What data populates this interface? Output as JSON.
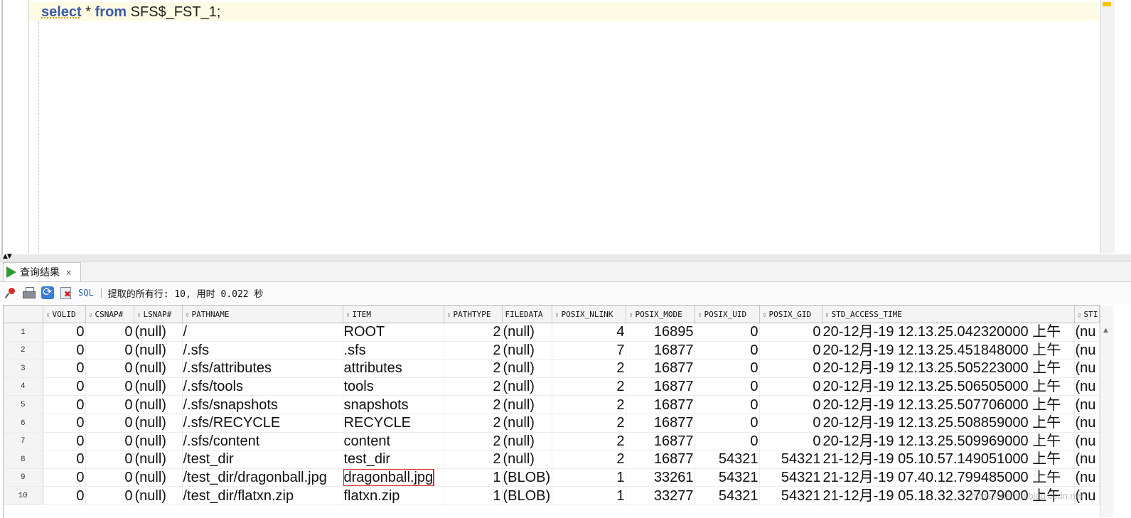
{
  "editor": {
    "sql_keyword_select": "select",
    "sql_star": "*",
    "sql_keyword_from": "from",
    "sql_table": "SFS$_FST_1;"
  },
  "results_tab": {
    "label": "查询结果",
    "close": "×"
  },
  "toolbar": {
    "sql_label": "SQL",
    "status": "提取的所有行: 10, 用时 0.022 秒"
  },
  "grid": {
    "columns": [
      "VOLID",
      "CSNAP#",
      "LSNAP#",
      "PATHNAME",
      "ITEM",
      "PATHTYPE",
      "FILEDATA",
      "POSIX_NLINK",
      "POSIX_MODE",
      "POSIX_UID",
      "POSIX_GID",
      "STD_ACCESS_TIME",
      "STI"
    ],
    "rows": [
      {
        "n": "1",
        "volid": "0",
        "csnap": "0",
        "lsnap": "(null)",
        "pathname": "/",
        "item": "ROOT",
        "pathtype": "2",
        "filedata": "(null)",
        "nlink": "4",
        "mode": "16895",
        "uid": "0",
        "gid": "0",
        "atime": "20-12月-19 12.13.25.042320000 上午",
        "next": "(nu"
      },
      {
        "n": "2",
        "volid": "0",
        "csnap": "0",
        "lsnap": "(null)",
        "pathname": "/.sfs",
        "item": ".sfs",
        "pathtype": "2",
        "filedata": "(null)",
        "nlink": "7",
        "mode": "16877",
        "uid": "0",
        "gid": "0",
        "atime": "20-12月-19 12.13.25.451848000 上午",
        "next": "(nu"
      },
      {
        "n": "3",
        "volid": "0",
        "csnap": "0",
        "lsnap": "(null)",
        "pathname": "/.sfs/attributes",
        "item": "attributes",
        "pathtype": "2",
        "filedata": "(null)",
        "nlink": "2",
        "mode": "16877",
        "uid": "0",
        "gid": "0",
        "atime": "20-12月-19 12.13.25.505223000 上午",
        "next": "(nu"
      },
      {
        "n": "4",
        "volid": "0",
        "csnap": "0",
        "lsnap": "(null)",
        "pathname": "/.sfs/tools",
        "item": "tools",
        "pathtype": "2",
        "filedata": "(null)",
        "nlink": "2",
        "mode": "16877",
        "uid": "0",
        "gid": "0",
        "atime": "20-12月-19 12.13.25.506505000 上午",
        "next": "(nu"
      },
      {
        "n": "5",
        "volid": "0",
        "csnap": "0",
        "lsnap": "(null)",
        "pathname": "/.sfs/snapshots",
        "item": "snapshots",
        "pathtype": "2",
        "filedata": "(null)",
        "nlink": "2",
        "mode": "16877",
        "uid": "0",
        "gid": "0",
        "atime": "20-12月-19 12.13.25.507706000 上午",
        "next": "(nu"
      },
      {
        "n": "6",
        "volid": "0",
        "csnap": "0",
        "lsnap": "(null)",
        "pathname": "/.sfs/RECYCLE",
        "item": "RECYCLE",
        "pathtype": "2",
        "filedata": "(null)",
        "nlink": "2",
        "mode": "16877",
        "uid": "0",
        "gid": "0",
        "atime": "20-12月-19 12.13.25.508859000 上午",
        "next": "(nu"
      },
      {
        "n": "7",
        "volid": "0",
        "csnap": "0",
        "lsnap": "(null)",
        "pathname": "/.sfs/content",
        "item": "content",
        "pathtype": "2",
        "filedata": "(null)",
        "nlink": "2",
        "mode": "16877",
        "uid": "0",
        "gid": "0",
        "atime": "20-12月-19 12.13.25.509969000 上午",
        "next": "(nu"
      },
      {
        "n": "8",
        "volid": "0",
        "csnap": "0",
        "lsnap": "(null)",
        "pathname": "/test_dir",
        "item": "test_dir",
        "pathtype": "2",
        "filedata": "(null)",
        "nlink": "2",
        "mode": "16877",
        "uid": "54321",
        "gid": "54321",
        "atime": "21-12月-19 05.10.57.149051000 上午",
        "next": "(nu"
      },
      {
        "n": "9",
        "volid": "0",
        "csnap": "0",
        "lsnap": "(null)",
        "pathname": "/test_dir/dragonball.jpg",
        "item": "dragonball.jpg",
        "pathtype": "1",
        "filedata": "(BLOB)",
        "nlink": "1",
        "mode": "33261",
        "uid": "54321",
        "gid": "54321",
        "atime": "21-12月-19 07.40.12.799485000 上午",
        "next": "(nu"
      },
      {
        "n": "10",
        "volid": "0",
        "csnap": "0",
        "lsnap": "(null)",
        "pathname": "/test_dir/flatxn.zip",
        "item": "flatxn.zip",
        "pathtype": "1",
        "filedata": "(BLOB)",
        "nlink": "1",
        "mode": "33277",
        "uid": "54321",
        "gid": "54321",
        "atime": "21-12月-19 05.18.32.327079000 上午",
        "next": "(nu"
      }
    ]
  },
  "watermark": "https://xiaoyu.blog.csdn.net",
  "colors": {
    "highlight_box": "#e02b2b",
    "run_icon": "#2e9a2e",
    "keyword": "#3c5aa6"
  }
}
